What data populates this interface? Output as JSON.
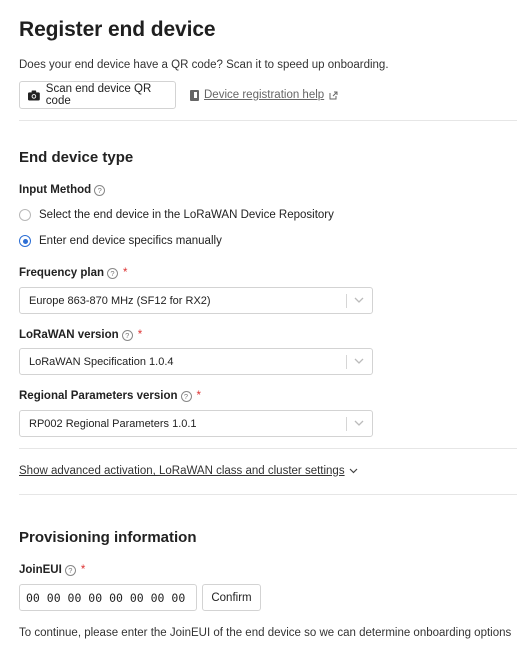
{
  "page": {
    "title": "Register end device",
    "qr_prompt": "Does your end device have a QR code? Scan it to speed up onboarding.",
    "scan_button_label": "Scan end device QR code",
    "help_link_label": "Device registration help"
  },
  "end_device_type": {
    "heading": "End device type",
    "input_method": {
      "label": "Input Method",
      "options": [
        {
          "label": "Select the end device in the LoRaWAN Device Repository",
          "selected": false
        },
        {
          "label": "Enter end device specifics manually",
          "selected": true
        }
      ]
    },
    "frequency_plan": {
      "label": "Frequency plan",
      "required_mark": "*",
      "value": "Europe 863-870 MHz (SF12 for RX2)"
    },
    "lorawan_version": {
      "label": "LoRaWAN version",
      "required_mark": "*",
      "value": "LoRaWAN Specification 1.0.4"
    },
    "regional_parameters": {
      "label": "Regional Parameters version",
      "required_mark": "*",
      "value": "RP002 Regional Parameters 1.0.1"
    },
    "advanced_toggle_label": "Show advanced activation, LoRaWAN class and cluster settings"
  },
  "provisioning": {
    "heading": "Provisioning information",
    "join_eui": {
      "label": "JoinEUI",
      "required_mark": "*",
      "value": "00 00 00 00 00 00 00 00"
    },
    "confirm_label": "Confirm",
    "note": "To continue, please enter the JoinEUI of the end device so we can determine onboarding options"
  },
  "colors": {
    "accent": "#2c6ed5",
    "required": "#dd3333",
    "border": "#d3d3d3"
  },
  "icons": {
    "camera": "camera-icon",
    "book": "book-icon",
    "external": "external-link-icon",
    "help": "help-icon",
    "chevron": "chevron-down-icon"
  }
}
